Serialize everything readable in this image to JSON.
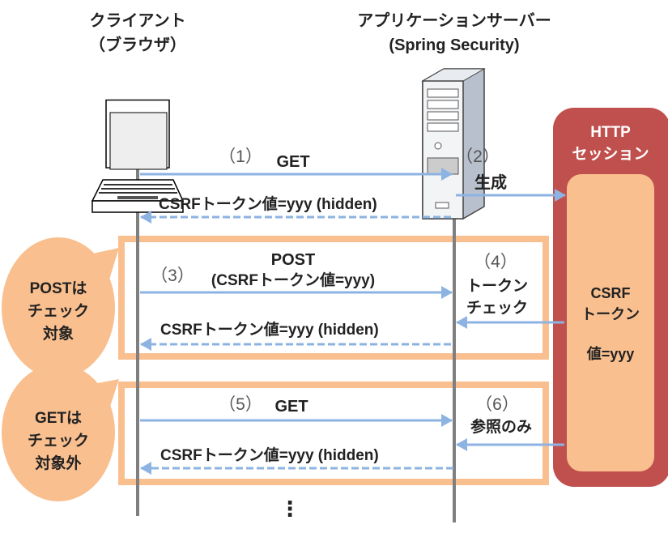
{
  "actors": {
    "client": {
      "name": "クライアント",
      "sub": "（ブラウザ）",
      "icon": "laptop-icon"
    },
    "server": {
      "name": "アプリケーションサーバー",
      "sub": "(Spring Security)",
      "icon": "server-icon"
    },
    "session": {
      "title1": "HTTP",
      "title2": "セッション",
      "token1": "CSRF",
      "token2": "トークン",
      "token3": "値=yyy"
    }
  },
  "steps": {
    "s1": {
      "num": "（1）",
      "label": "GET"
    },
    "s2": {
      "num": "（2）",
      "label": "生成"
    },
    "r1": {
      "label": "CSRFトークン値=yyy (hidden)"
    },
    "s3": {
      "num": "（3）",
      "label1": "POST",
      "label2": "(CSRFトークン値=yyy)"
    },
    "s4": {
      "num": "（4）",
      "label1": "トークン",
      "label2": "チェック"
    },
    "r2": {
      "label": "CSRFトークン値=yyy (hidden)"
    },
    "s5": {
      "num": "（5）",
      "label": "GET"
    },
    "s6": {
      "num": "（6）",
      "label": "参照のみ"
    },
    "r3": {
      "label": "CSRFトークン値=yyy (hidden)"
    }
  },
  "callouts": {
    "post": {
      "l1": "POSTは",
      "l2": "チェック",
      "l3": "対象"
    },
    "get": {
      "l1": "GETは",
      "l2": "チェック",
      "l3": "対象外"
    }
  },
  "ellipsis": "⋮",
  "colors": {
    "arrow": "#8db3e2",
    "frame": "#f9bf8f",
    "session": "#c0504d",
    "lifeline": "#7f7f7f"
  }
}
